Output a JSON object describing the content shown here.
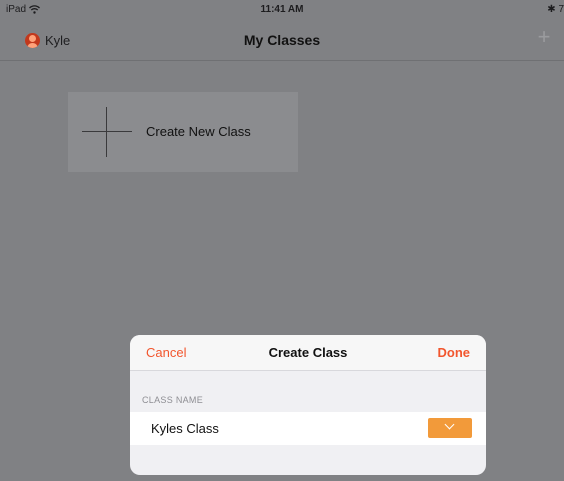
{
  "status_bar": {
    "device": "iPad",
    "wifi_icon": "wifi-icon",
    "time": "11:41 AM",
    "right_text": "✱ 7"
  },
  "nav": {
    "user_name": "Kyle",
    "title": "My Classes",
    "add_glyph": "+"
  },
  "main": {
    "create_card_label": "Create New Class"
  },
  "sheet": {
    "cancel_label": "Cancel",
    "title": "Create Class",
    "done_label": "Done",
    "section_label": "CLASS NAME",
    "class_name_value": "Kyles Class",
    "selected_color": "#f29a3a"
  },
  "colors": {
    "accent": "#f2562e",
    "dim_overlay_bg": "#808184",
    "color_swatch": "#f29a3a"
  }
}
